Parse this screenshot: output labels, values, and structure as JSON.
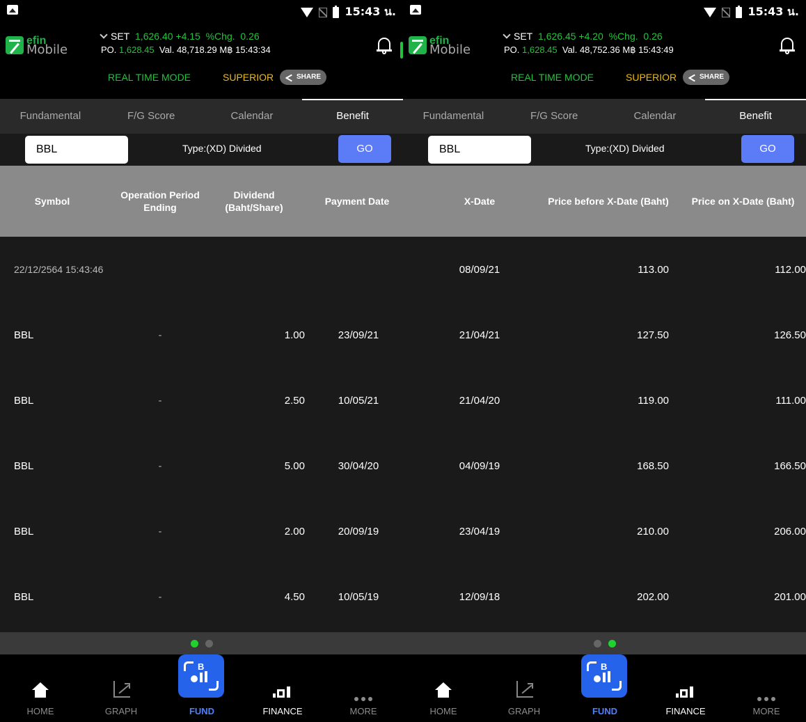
{
  "panels": [
    {
      "status": {
        "time": "15:43 น."
      },
      "header": {
        "logo_e": "efin",
        "logo_m": "Mobile",
        "set_label": "SET",
        "set_value": "1,626.40 +4.15",
        "chg_label": "%Chg.",
        "chg_value": "0.26",
        "po_label": "PO.",
        "po_value": "1,628.45",
        "val_label": "Val.",
        "val_value": "48,718.29 M฿ 15:43:34",
        "mode_realtime": "REAL TIME MODE",
        "mode_superior": "SUPERIOR",
        "share_label": "SHARE"
      },
      "tabs": [
        "Fundamental",
        "F/G Score",
        "Calendar",
        "Benefit"
      ],
      "search": {
        "symbol": "BBL",
        "type_label": "Type:(XD) Divided",
        "go_label": "GO"
      },
      "table": {
        "headers": [
          "Symbol",
          "Operation Period Ending",
          "Dividend (Baht/Share)",
          "Payment Date"
        ],
        "timestamp": "22/12/2564 15:43:46",
        "rows": [
          [
            "BBL",
            "-",
            "1.00",
            "23/09/21"
          ],
          [
            "BBL",
            "-",
            "2.50",
            "10/05/21"
          ],
          [
            "BBL",
            "-",
            "5.00",
            "30/04/20"
          ],
          [
            "BBL",
            "-",
            "2.00",
            "20/09/19"
          ],
          [
            "BBL",
            "-",
            "4.50",
            "10/05/19"
          ]
        ]
      },
      "pager_active": 0
    },
    {
      "status": {
        "time": "15:43 น."
      },
      "header": {
        "logo_e": "efin",
        "logo_m": "Mobile",
        "set_label": "SET",
        "set_value": "1,626.45 +4.20",
        "chg_label": "%Chg.",
        "chg_value": "0.26",
        "po_label": "PO.",
        "po_value": "1,628.45",
        "val_label": "Val.",
        "val_value": "48,752.36 M฿ 15:43:49",
        "mode_realtime": "REAL TIME MODE",
        "mode_superior": "SUPERIOR",
        "share_label": "SHARE"
      },
      "tabs": [
        "Fundamental",
        "F/G Score",
        "Calendar",
        "Benefit"
      ],
      "search": {
        "symbol": "BBL",
        "type_label": "Type:(XD) Divided",
        "go_label": "GO"
      },
      "table": {
        "headers": [
          "X-Date",
          "Price before X-Date (Baht)",
          "Price on X-Date (Baht)"
        ],
        "rows": [
          [
            "08/09/21",
            "113.00",
            "112.00"
          ],
          [
            "21/04/21",
            "127.50",
            "126.50"
          ],
          [
            "21/04/20",
            "119.00",
            "111.00"
          ],
          [
            "04/09/19",
            "168.50",
            "166.50"
          ],
          [
            "23/04/19",
            "210.00",
            "206.00"
          ],
          [
            "12/09/18",
            "202.00",
            "201.00"
          ]
        ]
      },
      "pager_active": 1
    }
  ],
  "nav": [
    "HOME",
    "GRAPH",
    "FUND",
    "FINANCE",
    "MORE"
  ],
  "colors": {
    "accent_green": "#25c23d",
    "superior_gold": "#f2b90c",
    "go_blue": "#5c7cf7",
    "fund_blue": "#2563eb"
  }
}
